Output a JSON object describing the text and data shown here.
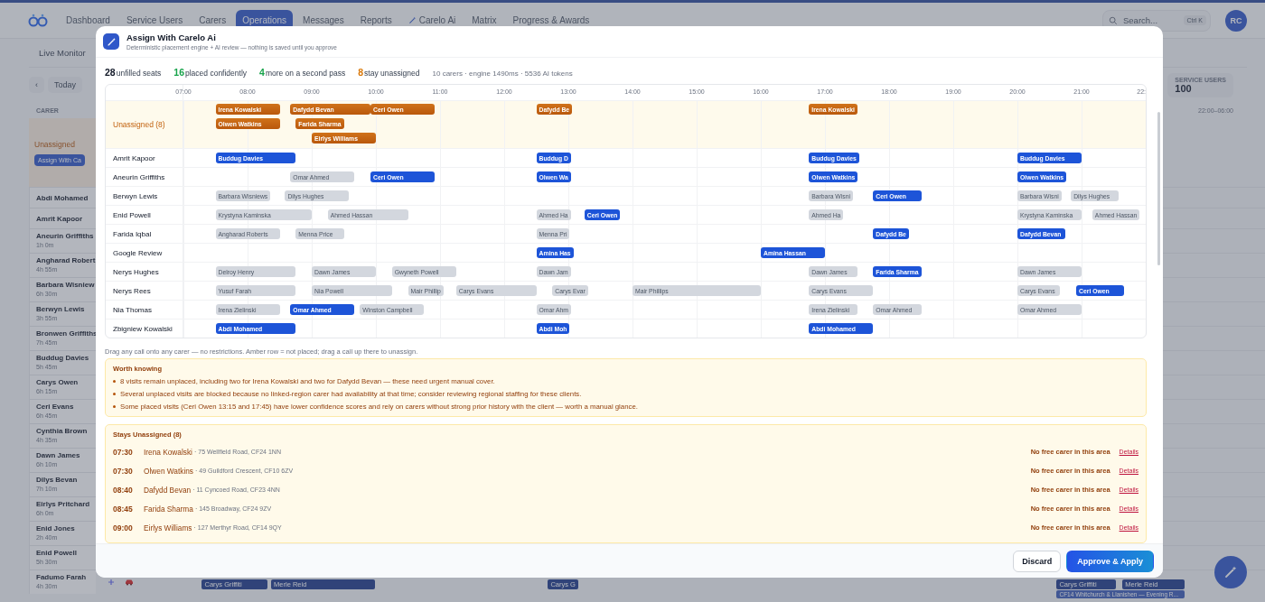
{
  "background": {
    "nav": [
      {
        "label": "Dashboard",
        "kind": "plain",
        "selected": false
      },
      {
        "label": "Service Users",
        "kind": "plain",
        "selected": false
      },
      {
        "label": "Carers",
        "kind": "plain",
        "selected": false
      },
      {
        "label": "Operations",
        "kind": "plain",
        "selected": true
      },
      {
        "label": "Messages",
        "kind": "plain",
        "selected": false
      },
      {
        "label": "Reports",
        "kind": "plain",
        "selected": false
      },
      {
        "label": "Carelo Ai",
        "kind": "ai",
        "selected": false
      },
      {
        "label": "Matrix",
        "kind": "plain",
        "selected": false
      },
      {
        "label": "Progress & Awards",
        "kind": "plain",
        "selected": false
      }
    ],
    "search": {
      "placeholder": "Search...",
      "shortcut": "Ctrl K"
    },
    "user_initials": "RC",
    "subnav": [
      "Live Monitor"
    ],
    "prev_button": "‹",
    "today_button": "Today",
    "stat_card": {
      "label": "SERVICE USERS",
      "value": "100"
    },
    "carer_header": "CARER",
    "night_header": "22:00–06:00",
    "unassigned": {
      "label": "Unassigned",
      "button": "Assign With Ca"
    },
    "carers": [
      {
        "name": "Abdi Mohamed"
      },
      {
        "name": "Amrit Kapoor"
      },
      {
        "name": "Aneurin Griffiths",
        "hours": "1h 0m"
      },
      {
        "name": "Angharad Robert",
        "hours": "4h 55m"
      },
      {
        "name": "Barbara Wisniew",
        "hours": "6h 30m"
      },
      {
        "name": "Berwyn Lewis",
        "hours": "3h 55m"
      },
      {
        "name": "Bronwen Griffiths",
        "hours": "7h 45m"
      },
      {
        "name": "Buddug Davies",
        "hours": "5h 45m"
      },
      {
        "name": "Carys Owen",
        "hours": "6h 15m"
      },
      {
        "name": "Ceri Evans",
        "hours": "6h 45m"
      },
      {
        "name": "Cynthia Brown",
        "hours": "4h 35m"
      },
      {
        "name": "Dawn James",
        "hours": "6h 10m"
      },
      {
        "name": "Dilys Bevan",
        "hours": "7h 10m"
      },
      {
        "name": "Eirlys Pritchard",
        "hours": "6h 0m"
      },
      {
        "name": "Enid Jones",
        "hours": "2h 40m"
      },
      {
        "name": "Enid Powell",
        "hours": "5h 30m"
      },
      {
        "name": "Fadumo Farah",
        "hours": "4h 30m",
        "shifts": [
          {
            "label": "Carys Griffiti",
            "kind": "visit"
          },
          {
            "label": "Merle Reid",
            "kind": "visit"
          },
          {
            "label": "Carys G",
            "kind": "visit"
          },
          {
            "label": "Carys Griffiti",
            "kind": "visit"
          },
          {
            "label": "Merle Reid",
            "kind": "visit"
          },
          {
            "label": "CF14 Whitchurch & Llanishen — Evening R...",
            "kind": "area"
          }
        ]
      }
    ]
  },
  "modal": {
    "title": "Assign With Carelo Ai",
    "subtitle": "Deterministic placement engine + AI review — nothing is saved until you approve",
    "stats": [
      {
        "kind": "total",
        "count": "28",
        "text": "unfilled seats"
      },
      {
        "kind": "confident",
        "count": "16",
        "text": "placed confidently"
      },
      {
        "kind": "second_pass",
        "count": "4",
        "text": "more on a second pass"
      },
      {
        "kind": "unassigned",
        "count": "8",
        "text": "stay unassigned"
      },
      {
        "kind": "meta",
        "text": "10 carers · engine 1490ms · 5536 AI tokens"
      }
    ],
    "timeline": {
      "ticks": [
        "07:00",
        "08:00",
        "09:00",
        "10:00",
        "11:00",
        "12:00",
        "13:00",
        "14:00",
        "15:00",
        "16:00",
        "17:00",
        "18:00",
        "19:00",
        "20:00",
        "21:00",
        "22:"
      ],
      "unassigned": {
        "label": "Unassigned (8)",
        "lanes": [
          [
            {
              "label": "Irena Kowalski",
              "kind": "unplaced"
            },
            {
              "label": "Dafydd Bevan",
              "kind": "unplaced"
            },
            {
              "label": "Ceri Owen",
              "kind": "unplaced"
            },
            {
              "label": "Dafydd Be",
              "kind": "unplaced"
            },
            {
              "label": "Irena Kowalski",
              "kind": "unplaced"
            }
          ],
          [
            {
              "label": "Olwen Watkins",
              "kind": "unplaced"
            },
            {
              "label": "Farida Sharma",
              "kind": "unplaced"
            }
          ],
          [
            {
              "label": "Eirlys Williams",
              "kind": "unplaced"
            }
          ]
        ]
      },
      "rows": [
        {
          "carer": "Amrit Kapoor",
          "bars": [
            {
              "label": "Buddug Davies",
              "kind": "placed"
            },
            {
              "label": "Buddug D",
              "kind": "placed"
            },
            {
              "label": "Buddug Davies",
              "kind": "placed"
            },
            {
              "label": "Buddug Davies",
              "kind": "placed"
            }
          ]
        },
        {
          "carer": "Aneurin Griffiths",
          "bars": [
            {
              "label": "Omar Ahmed",
              "kind": "existing"
            },
            {
              "label": "Ceri Owen",
              "kind": "placed"
            },
            {
              "label": "Olwen Wa",
              "kind": "placed"
            },
            {
              "label": "Olwen Watkins",
              "kind": "placed"
            },
            {
              "label": "Olwen Watkins",
              "kind": "placed"
            }
          ]
        },
        {
          "carer": "Berwyn Lewis",
          "bars": [
            {
              "label": "Barbara Wisniews",
              "kind": "existing"
            },
            {
              "label": "Dilys Hughes",
              "kind": "existing"
            },
            {
              "label": "Barbara Wisni",
              "kind": "existing"
            },
            {
              "label": "Ceri Owen",
              "kind": "placed"
            },
            {
              "label": "Barbara Wisni",
              "kind": "existing"
            },
            {
              "label": "Dilys Hughes",
              "kind": "existing"
            }
          ]
        },
        {
          "carer": "Enid Powell",
          "bars": [
            {
              "label": "Krystyna Kaminska",
              "kind": "existing"
            },
            {
              "label": "Ahmed Hassan",
              "kind": "existing"
            },
            {
              "label": "Ahmed Ha",
              "kind": "existing"
            },
            {
              "label": "Ceri Owen",
              "kind": "placed"
            },
            {
              "label": "Ahmed Ha",
              "kind": "existing"
            },
            {
              "label": "Krystyna Kaminska",
              "kind": "existing"
            },
            {
              "label": "Ahmed Hassan",
              "kind": "existing"
            }
          ]
        },
        {
          "carer": "Farida Iqbal",
          "bars": [
            {
              "label": "Angharad Roberts",
              "kind": "existing"
            },
            {
              "label": "Menna Price",
              "kind": "existing"
            },
            {
              "label": "Menna Pri",
              "kind": "existing"
            },
            {
              "label": "Dafydd Be",
              "kind": "placed"
            },
            {
              "label": "Dafydd Bevan",
              "kind": "placed"
            }
          ]
        },
        {
          "carer": "Google Review",
          "bars": [
            {
              "label": "Amina Has",
              "kind": "placed"
            },
            {
              "label": "Amina Hassan",
              "kind": "placed"
            }
          ]
        },
        {
          "carer": "Nerys Hughes",
          "bars": [
            {
              "label": "Delroy Henry",
              "kind": "existing"
            },
            {
              "label": "Dawn James",
              "kind": "existing"
            },
            {
              "label": "Gwyneth Powell",
              "kind": "existing"
            },
            {
              "label": "Dawn Jam",
              "kind": "existing"
            },
            {
              "label": "Dawn James",
              "kind": "existing"
            },
            {
              "label": "Farida Sharma",
              "kind": "placed"
            },
            {
              "label": "Dawn James",
              "kind": "existing"
            }
          ]
        },
        {
          "carer": "Nerys Rees",
          "bars": [
            {
              "label": "Yusuf Farah",
              "kind": "existing"
            },
            {
              "label": "Nia Powell",
              "kind": "existing"
            },
            {
              "label": "Mair Phillip",
              "kind": "existing"
            },
            {
              "label": "Carys Evans",
              "kind": "existing"
            },
            {
              "label": "Carys Evar",
              "kind": "existing"
            },
            {
              "label": "Mair Phillips",
              "kind": "existing"
            },
            {
              "label": "Carys Evans",
              "kind": "existing"
            },
            {
              "label": "Carys Evans",
              "kind": "existing"
            },
            {
              "label": "Ceri Owen",
              "kind": "placed"
            }
          ]
        },
        {
          "carer": "Nia Thomas",
          "bars": [
            {
              "label": "Irena Zielinski",
              "kind": "existing"
            },
            {
              "label": "Omar Ahmed",
              "kind": "placed"
            },
            {
              "label": "Winston Campbell",
              "kind": "existing"
            },
            {
              "label": "Omar Ahm",
              "kind": "existing"
            },
            {
              "label": "Irena Zielinski",
              "kind": "existing"
            },
            {
              "label": "Omar Ahmed",
              "kind": "existing"
            },
            {
              "label": "Omar Ahmed",
              "kind": "existing"
            }
          ]
        },
        {
          "carer": "Zbigniew Kowalski",
          "bars": [
            {
              "label": "Abdi Mohamed",
              "kind": "placed"
            },
            {
              "label": "Abdi Moh",
              "kind": "placed"
            },
            {
              "label": "Abdi Mohamed",
              "kind": "placed"
            }
          ]
        }
      ]
    },
    "hint": "Drag any call onto any carer — no restrictions. Amber row = not placed; drag a call up there to unassign.",
    "worth_knowing": {
      "title": "Worth knowing",
      "items": [
        "8 visits remain unplaced, including two for Irena Kowalski and two for Dafydd Bevan — these need urgent manual cover.",
        "Several unplaced visits are blocked because no linked-region carer had availability at that time; consider reviewing regional staffing for these clients.",
        "Some placed visits (Ceri Owen 13:15 and 17:45) have lower confidence scores and rely on carers without strong prior history with the client — worth a manual glance."
      ]
    },
    "stays_unassigned": {
      "title": "Stays Unassigned (8)",
      "rows": [
        {
          "time": "07:30",
          "name": "Irena Kowalski",
          "address": "· 75 Wellfield Road, CF24 1NN",
          "reason": "No free carer in this area",
          "action": "Details"
        },
        {
          "time": "07:30",
          "name": "Olwen Watkins",
          "address": "· 49 Guildford Crescent, CF10 6ZV",
          "reason": "No free carer in this area",
          "action": "Details"
        },
        {
          "time": "08:40",
          "name": "Dafydd Bevan",
          "address": "· 11 Cyncoed Road, CF23 4NN",
          "reason": "No free carer in this area",
          "action": "Details"
        },
        {
          "time": "08:45",
          "name": "Farida Sharma",
          "address": "· 145 Broadway, CF24 9ZV",
          "reason": "No free carer in this area",
          "action": "Details"
        },
        {
          "time": "09:00",
          "name": "Eirlys Williams",
          "address": "· 127 Merthyr Road, CF14 9QY",
          "reason": "No free carer in this area",
          "action": "Details"
        }
      ]
    },
    "buttons": [
      {
        "label": "Discard",
        "kind": "secondary"
      },
      {
        "label": "Approve & Apply",
        "kind": "primary"
      }
    ]
  }
}
